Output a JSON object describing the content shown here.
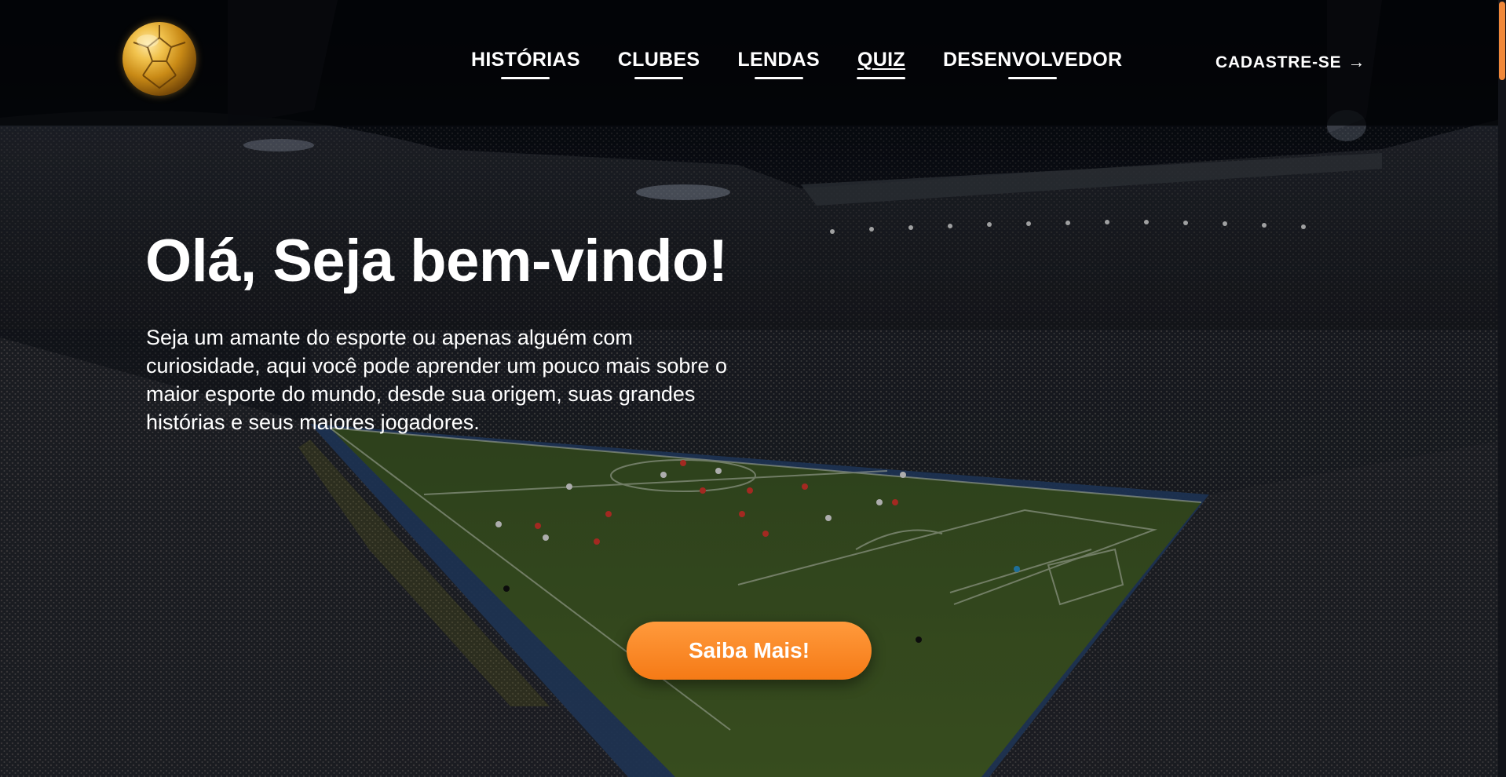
{
  "logo": {
    "icon": "golden-ball-icon"
  },
  "nav": {
    "items": [
      {
        "label": "HISTÓRIAS",
        "active": false
      },
      {
        "label": "CLUBES",
        "active": false
      },
      {
        "label": "LENDAS",
        "active": false
      },
      {
        "label": "QUIZ",
        "active": true
      },
      {
        "label": "DESENVOLVEDOR",
        "active": false
      }
    ],
    "signup_label": "CADASTRE-SE",
    "signup_icon": "arrow-right-icon"
  },
  "hero": {
    "title": "Olá, Seja bem-vindo!",
    "text": "Seja um amante do esporte ou apenas alguém com curiosidade, aqui você pode aprender um pouco mais sobre o maior esporte do mundo, desde sua origem, suas grandes histórias e seus maiores jogadores.",
    "cta_label": "Saiba Mais!"
  },
  "colors": {
    "accent": "#f5841f",
    "text": "#ffffff",
    "background": "#05070c"
  }
}
